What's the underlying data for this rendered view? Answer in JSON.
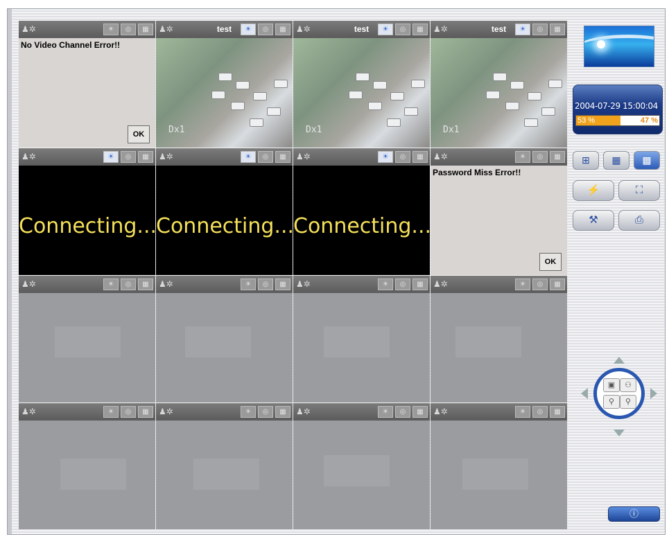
{
  "row1": [
    {
      "title": "",
      "type": "error",
      "message": "No Video Channel Error!!",
      "button": "OK"
    },
    {
      "title": "test",
      "type": "camera",
      "overlay": "Dx1"
    },
    {
      "title": "test",
      "type": "camera",
      "overlay": "Dx1"
    },
    {
      "title": "test",
      "type": "camera",
      "overlay": "Dx1"
    }
  ],
  "row2": [
    {
      "title": "",
      "type": "connecting",
      "text": "Connecting..."
    },
    {
      "title": "",
      "type": "connecting",
      "text": "Connecting..."
    },
    {
      "title": "",
      "type": "connecting",
      "text": "Connecting..."
    },
    {
      "title": "",
      "type": "error",
      "message": "Password Miss Error!!",
      "button": "OK"
    }
  ],
  "status": {
    "datetime": "2004-07-29 15:00:04",
    "left_percent_label": "53 %",
    "right_percent_label": "47 %",
    "usage_fraction": 0.53
  },
  "icons": {
    "layout_2x2": "four-split-icon",
    "layout_3x3": "nine-split-icon",
    "layout_4x4": "sixteen-split-icon",
    "connect": "connect-icon",
    "fullscreen": "fullscreen-icon",
    "settings": "settings-icon",
    "playback": "playback-icon",
    "power": "power-icon"
  },
  "power_glyph": "ⓘ",
  "colors": {
    "accent": "#2a57b0",
    "progress": "#f0a21c",
    "connecting_text": "#f5e05a"
  }
}
